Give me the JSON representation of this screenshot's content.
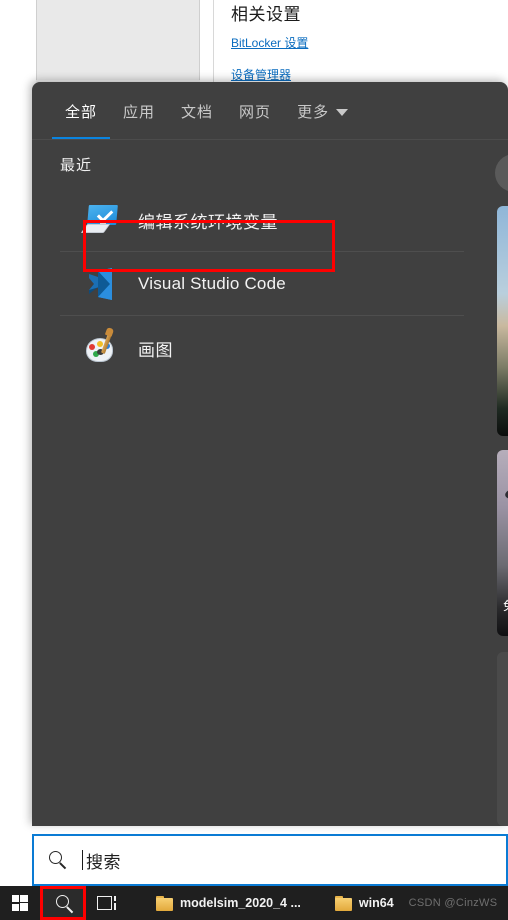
{
  "background_window": {
    "heading": "相关设置",
    "links": [
      "BitLocker 设置",
      "设备管理器"
    ],
    "link_color": "#0a6cbf"
  },
  "search_flyout": {
    "accent_color": "#0a84e0",
    "panel_color": "#404040",
    "tabs": [
      {
        "label": "全部",
        "active": true,
        "has_caret": false
      },
      {
        "label": "应用",
        "active": false,
        "has_caret": false
      },
      {
        "label": "文档",
        "active": false,
        "has_caret": false
      },
      {
        "label": "网页",
        "active": false,
        "has_caret": false
      },
      {
        "label": "更多",
        "active": false,
        "has_caret": true
      }
    ],
    "section_title": "最近",
    "results": [
      {
        "label": "编辑系统环境变量",
        "icon": "system-properties-icon",
        "highlighted": true
      },
      {
        "label": "Visual Studio Code",
        "icon": "vscode-icon",
        "highlighted": false
      },
      {
        "label": "画图",
        "icon": "paint-icon",
        "highlighted": false
      }
    ],
    "highlight_color": "#fe0000",
    "right_rail": {
      "scroll_button_glyph": "◀",
      "card_caption": "免"
    }
  },
  "search_box": {
    "placeholder": "搜索",
    "value": "",
    "icon": "search-icon",
    "border_color": "#0a7bd4"
  },
  "taskbar": {
    "background": "#1f1f1f",
    "start_icon": "windows-logo-icon",
    "search_icon": "search-icon",
    "search_highlighted": true,
    "task_view_icon": "task-view-icon",
    "apps": [
      {
        "label": "modelsim_2020_4 ...",
        "icon": "folder-icon"
      },
      {
        "label": "win64",
        "icon": "folder-icon"
      }
    ],
    "watermark": "CSDN @CinzWS"
  }
}
